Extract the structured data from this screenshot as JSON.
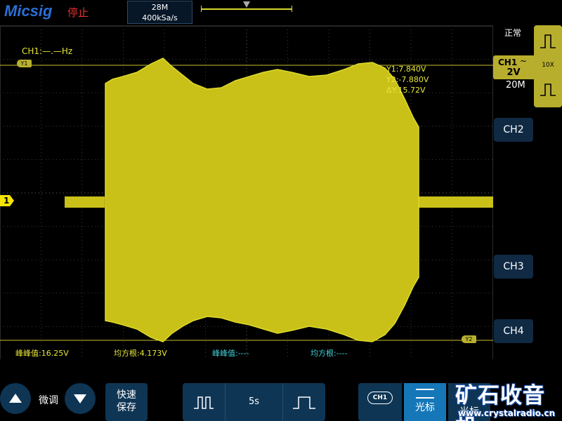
{
  "brand": "Micsig",
  "run_status": "停止",
  "timebase": {
    "memory_depth": "28M",
    "sample_rate": "400kSa/s"
  },
  "screen": {
    "ch1_frequency": "CH1:—.—Hz",
    "cursor": {
      "y1": "Y1:7.840V",
      "y2": "Y2:-7.880V",
      "dy": "ΔY:15.72V"
    },
    "cursor_tags": {
      "y1": "Y1",
      "y2": "Y2"
    },
    "ch1_marker": "1",
    "measurements": [
      {
        "label": "峰峰值:16.25V",
        "color": "#e6e63a"
      },
      {
        "label": "均方根:4.173V",
        "color": "#e6e63a"
      },
      {
        "label": "峰峰值:----",
        "color": "#3ed0d8"
      },
      {
        "label": "均方根:----",
        "color": "#3ed0d8"
      }
    ]
  },
  "right_panel": {
    "acquisition_mode": "正常",
    "ch1": {
      "name": "CH1",
      "coupling": "~",
      "scale": "2V",
      "bandwidth": "20M"
    },
    "probe_ratio": "10X",
    "channels": [
      "CH2",
      "CH3",
      "CH4"
    ]
  },
  "bottom_bar": {
    "fine_label": "微调",
    "quick_save": [
      "快速",
      "保存"
    ],
    "time_per_div": "5s",
    "channel_select": "CH1",
    "cursor_label": "光标",
    "extra_label": "光标"
  },
  "watermark": {
    "main": "矿石收音机",
    "url": "www.crystalradio.cn"
  },
  "colors": {
    "ch1": "#e6e63a",
    "ch2_accent": "#3ed0d8",
    "stop": "#e83030",
    "button": "#0e3554",
    "active": "#1577b8"
  }
}
